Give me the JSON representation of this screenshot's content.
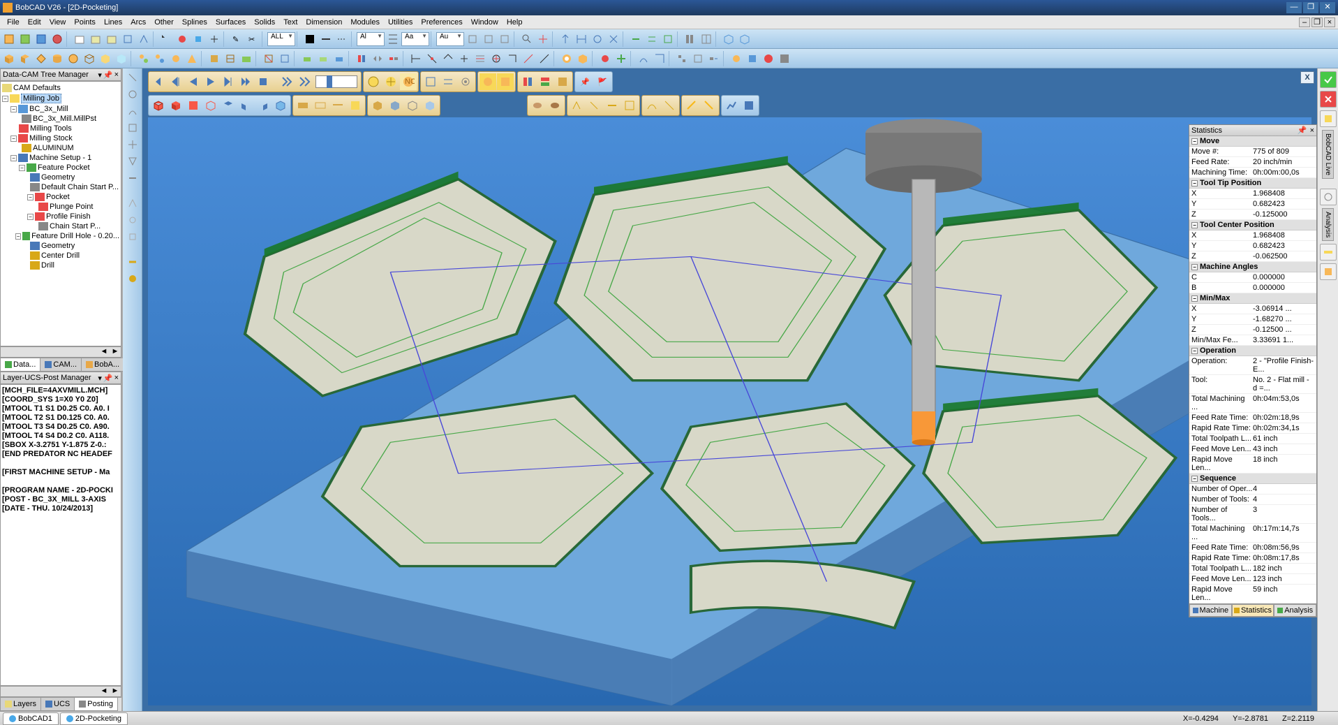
{
  "app": {
    "title": "BobCAD V26 - [2D-Pocketing]"
  },
  "menu": [
    "File",
    "Edit",
    "View",
    "Points",
    "Lines",
    "Arcs",
    "Other",
    "Splines",
    "Surfaces",
    "Solids",
    "Text",
    "Dimension",
    "Modules",
    "Utilities",
    "Preferences",
    "Window",
    "Help"
  ],
  "toolbar_combos": {
    "all": "ALL",
    "ali": "Al",
    "aa": "Aa",
    "au": "Au"
  },
  "tree_panel": {
    "title": "Data-CAM Tree Manager"
  },
  "tree": {
    "root": "CAM Defaults",
    "job": "Milling Job",
    "items": [
      "BC_3x_Mill",
      "BC_3x_Mill.MillPst",
      "Milling Tools",
      "Milling Stock",
      "ALUMINUM",
      "Machine Setup - 1",
      "Feature Pocket",
      "Geometry",
      "Default Chain Start P...",
      "Pocket",
      "Plunge Point",
      "Profile Finish",
      "Chain Start P...",
      "Feature Drill Hole - 0.20...",
      "Geometry",
      "Center Drill",
      "Drill"
    ]
  },
  "tree_tabs": [
    "Data...",
    "CAM...",
    "BobA..."
  ],
  "post_panel": {
    "title": "Layer-UCS-Post Manager"
  },
  "post_lines": [
    "[MCH_FILE=4AXVMILL.MCH]",
    "[COORD_SYS 1=X0 Y0 Z0]",
    "[MTOOL T1 S1 D0.25 C0. A0. I",
    "[MTOOL T2 S1 D0.125 C0. A0.",
    "[MTOOL T3 S4 D0.25 C0. A90.",
    "[MTOOL T4 S4 D0.2 C0. A118.",
    "[SBOX X-3.2751 Y-1.875 Z-0.:",
    "[END PREDATOR NC HEADEF",
    "",
    "[FIRST MACHINE SETUP - Ma",
    "",
    "[PROGRAM NAME - 2D-POCKI",
    "[POST -  BC_3X_MILL 3-AXIS",
    "[DATE - THU. 10/24/2013]"
  ],
  "post_tabs": [
    "Layers",
    "UCS",
    "Posting"
  ],
  "viewport": {
    "close": "X"
  },
  "stats": {
    "title": "Statistics",
    "sections": {
      "move": {
        "label": "Move",
        "rows": [
          [
            "Move #:",
            "775 of 809"
          ],
          [
            "Feed Rate:",
            "20 inch/min"
          ],
          [
            "Machining Time:",
            "0h:00m:00,0s"
          ]
        ]
      },
      "tooltip": {
        "label": "Tool Tip Position",
        "rows": [
          [
            "X",
            "1.968408"
          ],
          [
            "Y",
            "0.682423"
          ],
          [
            "Z",
            "-0.125000"
          ]
        ]
      },
      "toolcenter": {
        "label": "Tool Center Position",
        "rows": [
          [
            "X",
            "1.968408"
          ],
          [
            "Y",
            "0.682423"
          ],
          [
            "Z",
            "-0.062500"
          ]
        ]
      },
      "angles": {
        "label": "Machine Angles",
        "rows": [
          [
            "C",
            "0.000000"
          ],
          [
            "B",
            "0.000000"
          ]
        ]
      },
      "minmax": {
        "label": "Min/Max",
        "rows": [
          [
            "X",
            "-3.06914    ..."
          ],
          [
            "Y",
            "-1.68270    ..."
          ],
          [
            "Z",
            "-0.12500    ..."
          ],
          [
            "Min/Max Fe...",
            "3.33691    1..."
          ]
        ]
      },
      "operation": {
        "label": "Operation",
        "rows": [
          [
            "Operation:",
            "2 - \"Profile Finish-E..."
          ],
          [
            "Tool:",
            "No. 2 - Flat mill - d =..."
          ],
          [
            "Total Machining ...",
            "0h:04m:53,0s"
          ],
          [
            "Feed Rate Time:",
            "0h:02m:18,9s"
          ],
          [
            "Rapid Rate Time:",
            "0h:02m:34,1s"
          ],
          [
            "Total Toolpath L...",
            "61 inch"
          ],
          [
            "Feed Move Len...",
            "43 inch"
          ],
          [
            "Rapid Move Len...",
            "18 inch"
          ]
        ]
      },
      "sequence": {
        "label": "Sequence",
        "rows": [
          [
            "Number of Oper...",
            "4"
          ],
          [
            "Number of Tools:",
            "4"
          ],
          [
            "Number of Tools...",
            "3"
          ],
          [
            "Total Machining ...",
            "0h:17m:14,7s"
          ],
          [
            "Feed Rate Time:",
            "0h:08m:56,9s"
          ],
          [
            "Rapid Rate Time:",
            "0h:08m:17,8s"
          ],
          [
            "Total Toolpath L...",
            "182 inch"
          ],
          [
            "Feed Move Len...",
            "123 inch"
          ],
          [
            "Rapid Move Len...",
            "59 inch"
          ]
        ]
      }
    },
    "tabs": [
      "Machine",
      "Statistics",
      "Analysis"
    ]
  },
  "right_rail": {
    "labels": [
      "BobCAD Live",
      "Analysis"
    ]
  },
  "statusbar": {
    "tabs": [
      "BobCAD1",
      "2D-Pocketing"
    ],
    "coords": [
      "X=-0.4294",
      "Y=-2.8781",
      "Z=2.2119"
    ]
  }
}
